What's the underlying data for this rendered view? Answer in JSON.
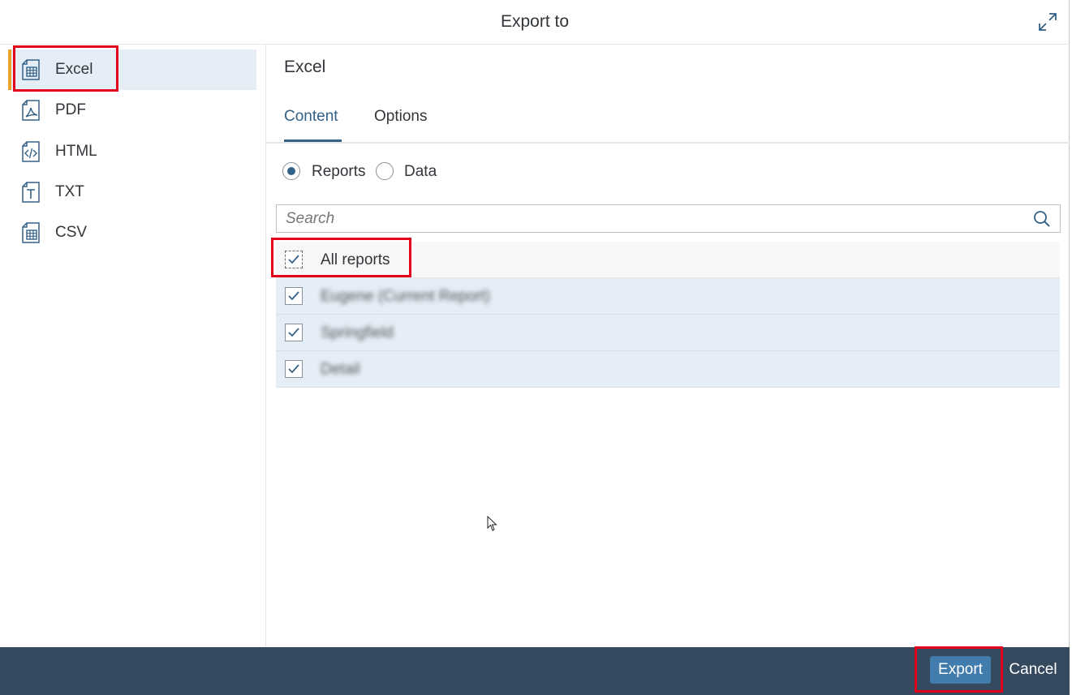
{
  "dialog": {
    "title": "Export to",
    "maximize_icon": "maximize-icon"
  },
  "sidebar": {
    "items": [
      {
        "label": "Excel",
        "icon": "excel-file-icon",
        "selected": true
      },
      {
        "label": "PDF",
        "icon": "pdf-file-icon",
        "selected": false
      },
      {
        "label": "HTML",
        "icon": "html-file-icon",
        "selected": false
      },
      {
        "label": "TXT",
        "icon": "txt-file-icon",
        "selected": false
      },
      {
        "label": "CSV",
        "icon": "csv-file-icon",
        "selected": false
      }
    ]
  },
  "main": {
    "title": "Excel",
    "tabs": [
      {
        "label": "Content",
        "active": true
      },
      {
        "label": "Options",
        "active": false
      }
    ],
    "radios": [
      {
        "label": "Reports",
        "checked": true
      },
      {
        "label": "Data",
        "checked": false
      }
    ],
    "search": {
      "placeholder": "Search",
      "value": "",
      "icon": "search-icon"
    },
    "list": {
      "header": {
        "label": "All reports",
        "checked": true
      },
      "items": [
        {
          "label": "Eugene (Current Report)",
          "checked": true,
          "blurred": true
        },
        {
          "label": "Springfield",
          "checked": true,
          "blurred": true
        },
        {
          "label": "Detail",
          "checked": true,
          "blurred": true
        }
      ]
    }
  },
  "footer": {
    "export_label": "Export",
    "cancel_label": "Cancel"
  },
  "colors": {
    "accent": "#346187",
    "selection_bar": "#e9a52a",
    "selected_bg": "#e5edf6",
    "footer_bg": "#354a5f",
    "emphasized_button": "#427cac",
    "highlight_box": "#e3001b"
  }
}
